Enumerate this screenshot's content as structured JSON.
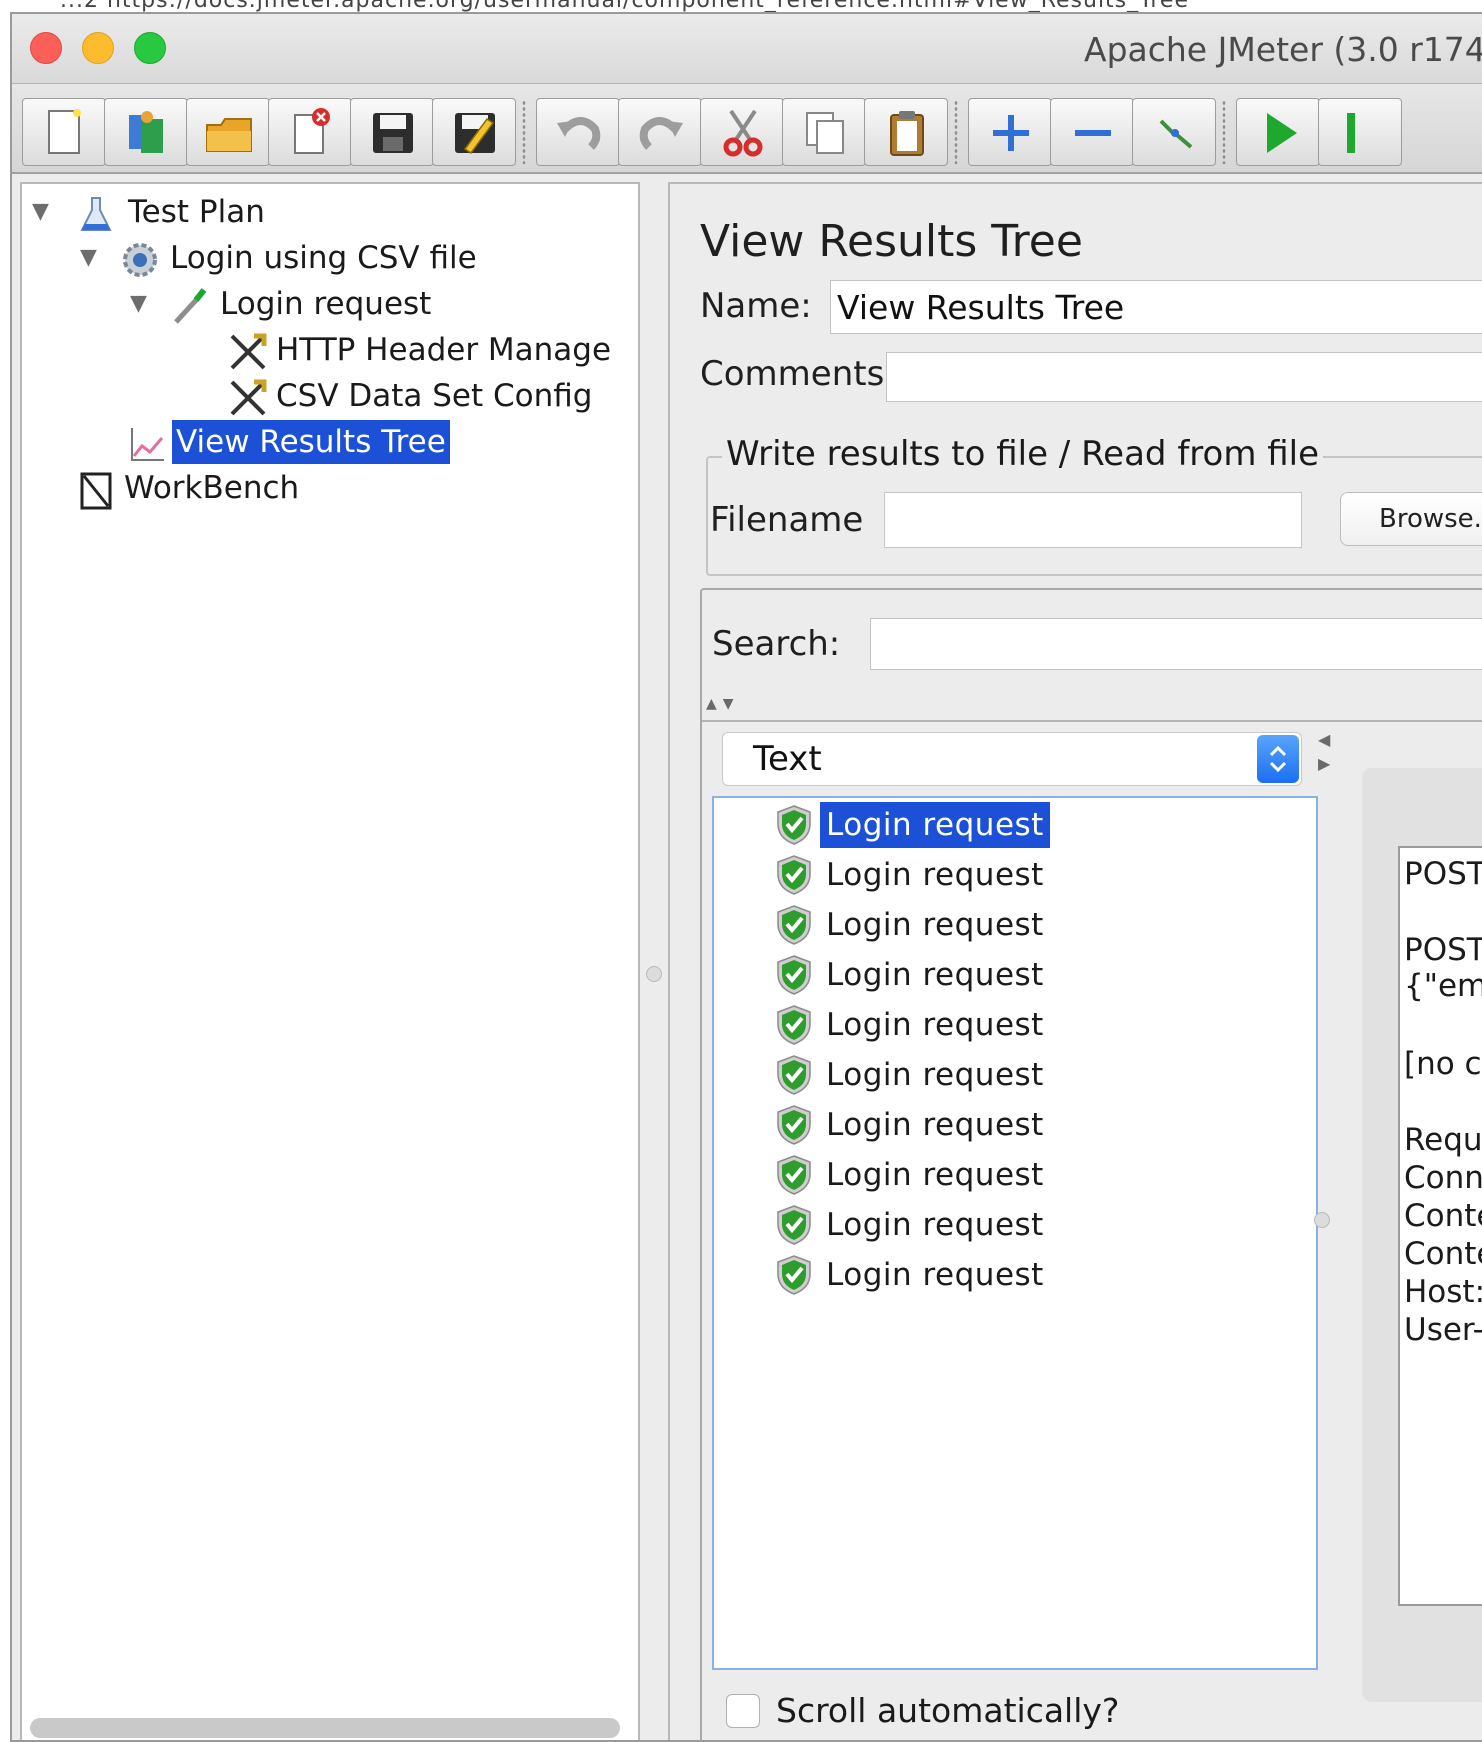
{
  "window": {
    "title": "Apache JMeter (3.0 r174",
    "overflow_text": "...2 https://docs.jmeter.apache.org/usermanual/component_reference.html#View_Results_Tree"
  },
  "toolbar": {
    "buttons": [
      {
        "name": "new",
        "icon": "new-document-icon"
      },
      {
        "name": "templates",
        "icon": "templates-icon"
      },
      {
        "name": "open",
        "icon": "open-folder-icon"
      },
      {
        "name": "close",
        "icon": "close-document-icon"
      },
      {
        "name": "save",
        "icon": "save-icon"
      },
      {
        "name": "save-as",
        "icon": "save-as-icon"
      },
      {
        "name": "undo",
        "icon": "undo-icon"
      },
      {
        "name": "redo",
        "icon": "redo-icon"
      },
      {
        "name": "cut",
        "icon": "cut-icon"
      },
      {
        "name": "copy",
        "icon": "copy-icon"
      },
      {
        "name": "paste",
        "icon": "paste-icon"
      },
      {
        "name": "expand",
        "icon": "expand-icon"
      },
      {
        "name": "collapse",
        "icon": "collapse-icon"
      },
      {
        "name": "toggle",
        "icon": "toggle-icon"
      },
      {
        "name": "start",
        "icon": "play-icon"
      }
    ]
  },
  "tree": {
    "items": [
      {
        "label": "Test Plan",
        "icon": "flask-icon"
      },
      {
        "label": "Login using CSV file",
        "icon": "gear-icon"
      },
      {
        "label": "Login request",
        "icon": "pipette-icon"
      },
      {
        "label": "HTTP Header Manage",
        "icon": "tools-icon"
      },
      {
        "label": "CSV Data Set Config",
        "icon": "tools-icon"
      },
      {
        "label": "View Results Tree",
        "icon": "chart-icon",
        "selected": true
      },
      {
        "label": "WorkBench",
        "icon": "workbench-icon"
      }
    ]
  },
  "main": {
    "title": "View Results Tree",
    "name_label": "Name:",
    "name_value": "View Results Tree",
    "comments_label": "Comments:",
    "comments_value": "",
    "file_section_legend": "Write results to file / Read from file",
    "filename_label": "Filename",
    "filename_value": "",
    "browse_label": "Browse...",
    "search_label": "Search:",
    "search_value": "",
    "renderer_selected": "Text",
    "results": [
      {
        "label": "Login request",
        "status": "success",
        "selected": true
      },
      {
        "label": "Login request",
        "status": "success"
      },
      {
        "label": "Login request",
        "status": "success"
      },
      {
        "label": "Login request",
        "status": "success"
      },
      {
        "label": "Login request",
        "status": "success"
      },
      {
        "label": "Login request",
        "status": "success"
      },
      {
        "label": "Login request",
        "status": "success"
      },
      {
        "label": "Login request",
        "status": "success"
      },
      {
        "label": "Login request",
        "status": "success"
      },
      {
        "label": "Login request",
        "status": "success"
      }
    ],
    "detail_lines": [
      "POST",
      "",
      "POST",
      "{\"ema",
      "",
      "[no co",
      "",
      "Reque",
      "Conne",
      "Conte",
      "Conte",
      "Host:",
      "User-"
    ],
    "scroll_auto_label": "Scroll automatically?",
    "scroll_auto_checked": false
  },
  "colors": {
    "selection": "#1c50d6",
    "success_shield": "#2e9d2e"
  }
}
